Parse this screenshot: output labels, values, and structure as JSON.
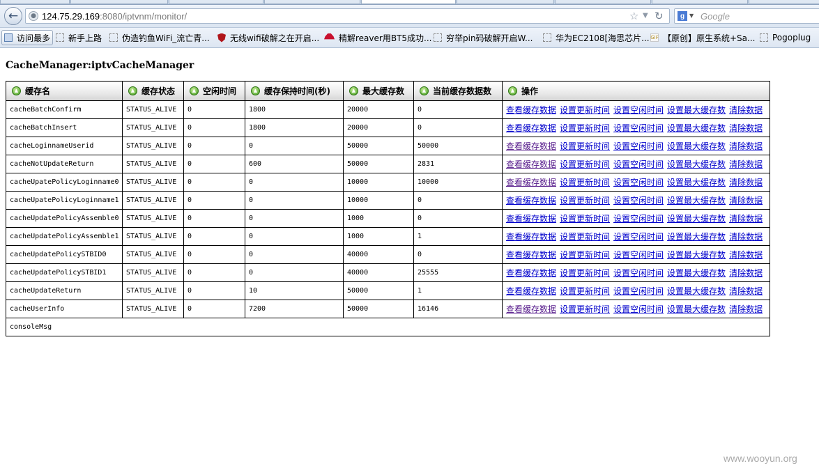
{
  "browser": {
    "url_host": "124.75.29.169",
    "url_rest": ":8080/iptvnm/monitor/",
    "search_placeholder": "Google",
    "search_engine_letter": "g",
    "bookmarks": [
      {
        "label": "访问最多",
        "icon": "page-icon"
      },
      {
        "label": "新手上路",
        "icon": "dashed-page-icon"
      },
      {
        "label": "伪造钓鱼WiFi_流亡青...",
        "icon": "dashed-page-icon"
      },
      {
        "label": "无线wifi破解之在开启...",
        "icon": "shield-icon"
      },
      {
        "label": "精解reaver用BT5成功...",
        "icon": "redhat-icon"
      },
      {
        "label": "穷举pin码破解开启W...",
        "icon": "dashed-page-icon"
      },
      {
        "label": "华为EC2108[海思芯片...",
        "icon": "dashed-page-icon"
      },
      {
        "label": "【原创】原生系统+Sa...",
        "icon": "image-icon"
      },
      {
        "label": "Pogoplug",
        "icon": "dashed-page-icon"
      }
    ]
  },
  "page": {
    "title": "CacheManager:iptvCacheManager",
    "headers": [
      "缓存名",
      "缓存状态",
      "空闲时间",
      "缓存保持时间(秒)",
      "最大缓存数",
      "当前缓存数据数",
      "操作"
    ],
    "actions": [
      "查看缓存数据",
      "设置更新时间",
      "设置空闲时间",
      "设置最大缓存数",
      "清除数据"
    ],
    "rows": [
      {
        "name": "cacheBatchConfirm",
        "status": "STATUS_ALIVE",
        "idle": "0",
        "keep": "1800",
        "max": "20000",
        "current": "0"
      },
      {
        "name": "cacheBatchInsert",
        "status": "STATUS_ALIVE",
        "idle": "0",
        "keep": "1800",
        "max": "20000",
        "current": "0"
      },
      {
        "name": "cacheLoginnameUserid",
        "status": "STATUS_ALIVE",
        "idle": "0",
        "keep": "0",
        "max": "50000",
        "current": "50000"
      },
      {
        "name": "cacheNotUpdateReturn",
        "status": "STATUS_ALIVE",
        "idle": "0",
        "keep": "600",
        "max": "50000",
        "current": "2831"
      },
      {
        "name": "cacheUpatePolicyLoginname0",
        "status": "STATUS_ALIVE",
        "idle": "0",
        "keep": "0",
        "max": "10000",
        "current": "10000"
      },
      {
        "name": "cacheUpatePolicyLoginname1",
        "status": "STATUS_ALIVE",
        "idle": "0",
        "keep": "0",
        "max": "10000",
        "current": "0"
      },
      {
        "name": "cacheUpdatePolicyAssemble0",
        "status": "STATUS_ALIVE",
        "idle": "0",
        "keep": "0",
        "max": "1000",
        "current": "0"
      },
      {
        "name": "cacheUpdatePolicyAssemble1",
        "status": "STATUS_ALIVE",
        "idle": "0",
        "keep": "0",
        "max": "1000",
        "current": "1"
      },
      {
        "name": "cacheUpdatePolicySTBID0",
        "status": "STATUS_ALIVE",
        "idle": "0",
        "keep": "0",
        "max": "40000",
        "current": "0"
      },
      {
        "name": "cacheUpdatePolicySTBID1",
        "status": "STATUS_ALIVE",
        "idle": "0",
        "keep": "0",
        "max": "40000",
        "current": "25555"
      },
      {
        "name": "cacheUpdateReturn",
        "status": "STATUS_ALIVE",
        "idle": "0",
        "keep": "10",
        "max": "50000",
        "current": "1"
      },
      {
        "name": "cacheUserInfo",
        "status": "STATUS_ALIVE",
        "idle": "0",
        "keep": "7200",
        "max": "50000",
        "current": "16146"
      }
    ],
    "console_label": "consoleMsg"
  },
  "watermark": "www.wooyun.org",
  "colors": {
    "link": "#0000cc",
    "link_visited": "#551a8b",
    "sort_icon": "#3f9a1c"
  }
}
